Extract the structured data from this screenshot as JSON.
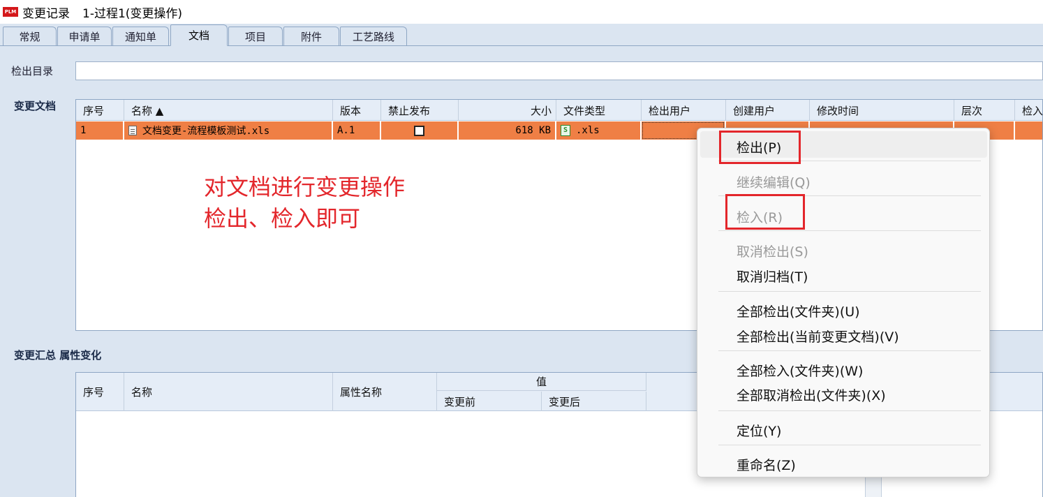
{
  "window": {
    "logo": "PLM",
    "title": "变更记录",
    "subtitle": "1-过程1(变更操作)"
  },
  "tabs": [
    {
      "label": "常规",
      "active": false
    },
    {
      "label": "申请单",
      "active": false
    },
    {
      "label": "通知单",
      "active": false
    },
    {
      "label": "文档",
      "active": true
    },
    {
      "label": "项目",
      "active": false
    },
    {
      "label": "附件",
      "active": false
    },
    {
      "label": "工艺路线",
      "active": false
    }
  ],
  "checkout_dir": {
    "label": "检出目录",
    "value": ""
  },
  "change_docs": {
    "label": "变更文档",
    "columns": [
      "序号",
      "名称 ▲",
      "版本",
      "禁止发布",
      "大小",
      "文件类型",
      "检出用户",
      "创建用户",
      "修改时间",
      "层次",
      "检入"
    ],
    "rows": [
      {
        "index": "1",
        "name": "文档变更-流程模板测试.xls",
        "version": "A.1",
        "forbid_publish": false,
        "size": "618 KB",
        "file_type": ".xls",
        "checkout_user": "",
        "creator": "",
        "modified": "",
        "level": "",
        "checkin": ""
      }
    ]
  },
  "annotation": {
    "line1": "对文档进行变更操作",
    "line2": "检出、检入即可"
  },
  "summary": {
    "label1": "变更汇总",
    "label2": "属性变化",
    "columns": {
      "index": "序号",
      "name": "名称",
      "attr_name": "属性名称",
      "value": "值",
      "before": "变更前",
      "after": "变更后"
    }
  },
  "context_menu": {
    "items": [
      {
        "label": "检出(P)",
        "enabled": true,
        "highlighted": true
      },
      {
        "label": "继续编辑(Q)",
        "enabled": false
      },
      {
        "label": "检入(R)",
        "enabled": false
      },
      {
        "label": "取消检出(S)",
        "enabled": false
      },
      {
        "label": "取消归档(T)",
        "enabled": true
      },
      {
        "label": "全部检出(文件夹)(U)",
        "enabled": true
      },
      {
        "label": "全部检出(当前变更文档)(V)",
        "enabled": true
      },
      {
        "label": "全部检入(文件夹)(W)",
        "enabled": true
      },
      {
        "label": "全部取消检出(文件夹)(X)",
        "enabled": true
      },
      {
        "label": "定位(Y)",
        "enabled": true
      },
      {
        "label": "重命名(Z)",
        "enabled": true
      }
    ]
  },
  "colors": {
    "selected_row": "#ef7f45",
    "annotation_red": "#e3262b",
    "background": "#dbe5f1"
  }
}
